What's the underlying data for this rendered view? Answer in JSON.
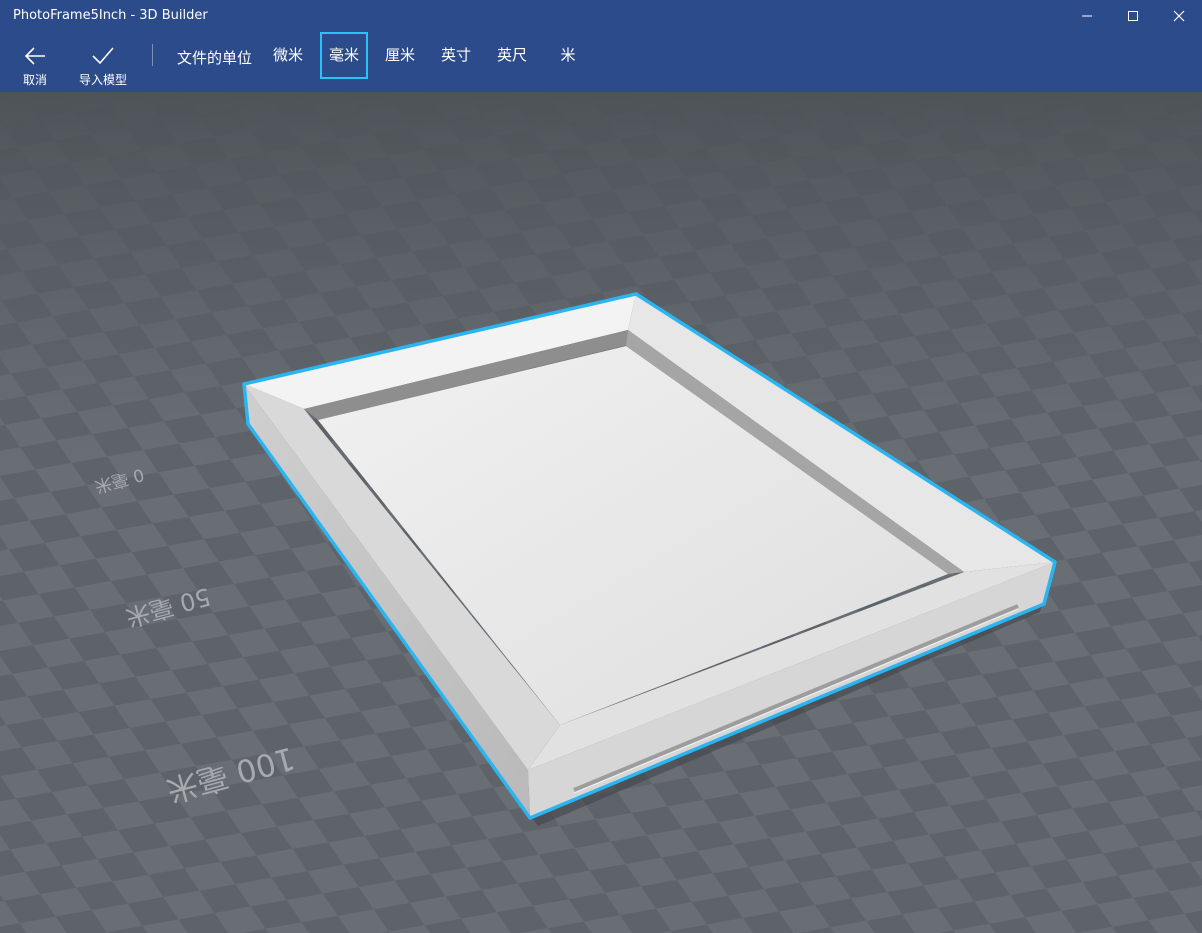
{
  "window": {
    "title": "PhotoFrame5Inch - 3D Builder",
    "controls": [
      "minimize-icon",
      "maximize-icon",
      "close-icon"
    ]
  },
  "toolbar": {
    "cancel_label": "取消",
    "import_label": "导入模型",
    "units_label": "文件的单位",
    "units": [
      "微米",
      "毫米",
      "厘米",
      "英寸",
      "英尺",
      "米"
    ],
    "selected_unit": "毫米"
  },
  "scene": {
    "scale_labels": [
      "0 毫米",
      "50 毫米",
      "100 毫米"
    ],
    "model": "photo-frame",
    "selection_color": "#2bb5f0",
    "grid_colors": [
      "#5c6268",
      "#666c72"
    ]
  },
  "colors": {
    "titlebar": "#2c4b8a",
    "accent": "#2bc3f5"
  }
}
